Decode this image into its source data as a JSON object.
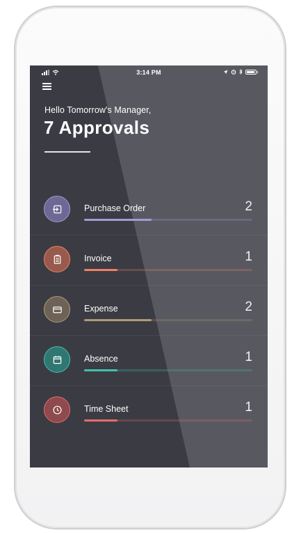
{
  "status_bar": {
    "time": "3:14 PM",
    "icons": [
      "signal-icon",
      "wifi-icon",
      "location-icon",
      "alarm-icon",
      "bluetooth-icon",
      "battery-icon"
    ]
  },
  "header": {
    "menu_icon": "hamburger-menu-icon",
    "greeting": "Hello Tomorrow's Manager,",
    "title": "7 Approvals"
  },
  "approvals": [
    {
      "label": "Purchase Order",
      "count": "2",
      "icon": "sign-in-icon",
      "color": "#a59ad6",
      "progress": 0.4
    },
    {
      "label": "Invoice",
      "count": "1",
      "icon": "clipboard-icon",
      "color": "#ef8067",
      "progress": 0.2
    },
    {
      "label": "Expense",
      "count": "2",
      "icon": "card-icon",
      "color": "#b09a78",
      "progress": 0.4
    },
    {
      "label": "Absence",
      "count": "1",
      "icon": "calendar-icon",
      "color": "#44c1b0",
      "progress": 0.2
    },
    {
      "label": "Time Sheet",
      "count": "1",
      "icon": "clock-icon",
      "color": "#e96b6b",
      "progress": 0.2
    }
  ]
}
